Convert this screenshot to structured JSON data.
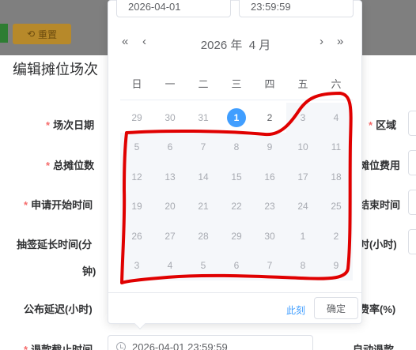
{
  "toolbar": {
    "reset_label": "重置"
  },
  "dialog": {
    "title": "编辑摊位场次"
  },
  "form": {
    "labels": {
      "session_date": "场次日期",
      "total_stalls": "总摊位数",
      "apply_start": "申请开始时间",
      "draw_delay": "抽签延长时间(分",
      "draw_delay_unit": "钟)",
      "publish_delay": "公布延迟(小时)",
      "refund_deadline": "退款截止时间",
      "area": "区域",
      "stall_fee": "摊位费用",
      "end_time": "结束时间",
      "hours": "时(小时)",
      "rate": "费率(%)",
      "auto_refund": "自动退款"
    },
    "refund_deadline_value": "2026-04-01 23:59:59"
  },
  "picker": {
    "date_value": "2026-04-01",
    "time_value": "23:59:59",
    "year": "2026 年",
    "month": "4 月",
    "nav": {
      "prev_year": "«",
      "prev_month": "‹",
      "next_month": "›",
      "next_year": "»"
    },
    "weekdays": [
      "日",
      "一",
      "二",
      "三",
      "四",
      "五",
      "六"
    ],
    "weeks": [
      [
        {
          "d": "29",
          "s": "prev"
        },
        {
          "d": "30",
          "s": "prev"
        },
        {
          "d": "31",
          "s": "prev"
        },
        {
          "d": "1",
          "s": "today"
        },
        {
          "d": "2",
          "s": "current"
        },
        {
          "d": "3",
          "s": "disabled"
        },
        {
          "d": "4",
          "s": "disabled"
        }
      ],
      [
        {
          "d": "5",
          "s": "disabled"
        },
        {
          "d": "6",
          "s": "disabled"
        },
        {
          "d": "7",
          "s": "disabled"
        },
        {
          "d": "8",
          "s": "disabled"
        },
        {
          "d": "9",
          "s": "disabled"
        },
        {
          "d": "10",
          "s": "disabled"
        },
        {
          "d": "11",
          "s": "disabled"
        }
      ],
      [
        {
          "d": "12",
          "s": "disabled"
        },
        {
          "d": "13",
          "s": "disabled"
        },
        {
          "d": "14",
          "s": "disabled"
        },
        {
          "d": "15",
          "s": "disabled"
        },
        {
          "d": "16",
          "s": "disabled"
        },
        {
          "d": "17",
          "s": "disabled"
        },
        {
          "d": "18",
          "s": "disabled"
        }
      ],
      [
        {
          "d": "19",
          "s": "disabled"
        },
        {
          "d": "20",
          "s": "disabled"
        },
        {
          "d": "21",
          "s": "disabled"
        },
        {
          "d": "22",
          "s": "disabled"
        },
        {
          "d": "23",
          "s": "disabled"
        },
        {
          "d": "24",
          "s": "disabled"
        },
        {
          "d": "25",
          "s": "disabled"
        }
      ],
      [
        {
          "d": "26",
          "s": "disabled"
        },
        {
          "d": "27",
          "s": "disabled"
        },
        {
          "d": "28",
          "s": "disabled"
        },
        {
          "d": "29",
          "s": "disabled"
        },
        {
          "d": "30",
          "s": "disabled"
        },
        {
          "d": "1",
          "s": "disabled"
        },
        {
          "d": "2",
          "s": "disabled"
        }
      ],
      [
        {
          "d": "3",
          "s": "disabled"
        },
        {
          "d": "4",
          "s": "disabled"
        },
        {
          "d": "5",
          "s": "disabled"
        },
        {
          "d": "6",
          "s": "disabled"
        },
        {
          "d": "7",
          "s": "disabled"
        },
        {
          "d": "8",
          "s": "disabled"
        },
        {
          "d": "9",
          "s": "disabled"
        }
      ]
    ],
    "now_label": "此刻",
    "confirm_label": "确定"
  },
  "colors": {
    "accent": "#409eff",
    "required": "#f56c6c",
    "annotation": "#e00000"
  }
}
